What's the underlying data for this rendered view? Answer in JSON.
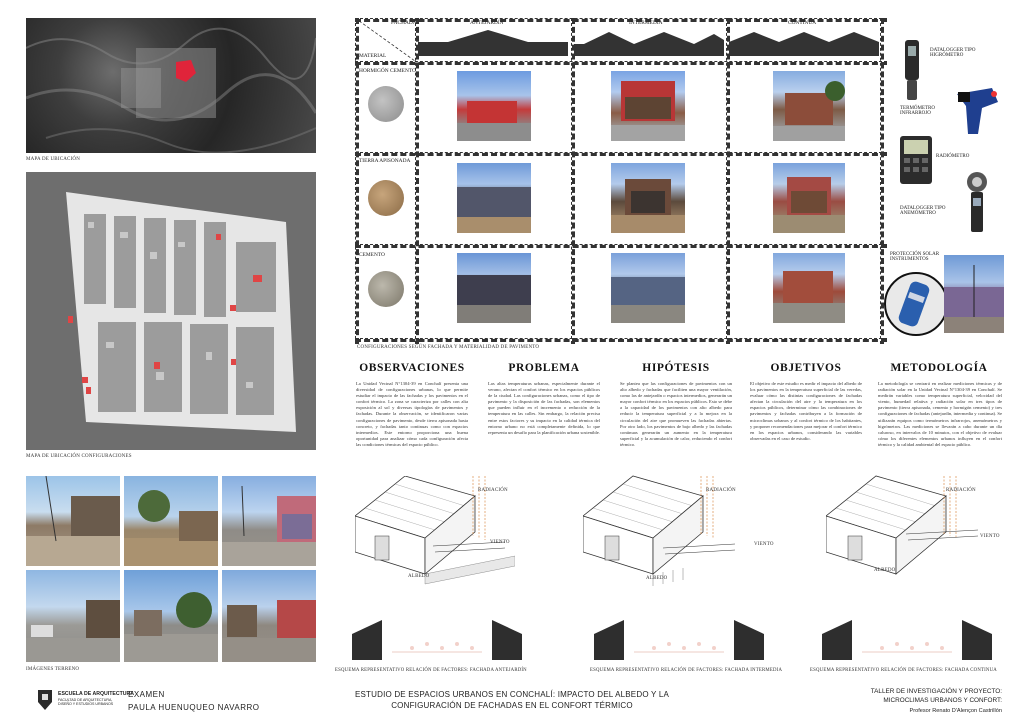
{
  "maps": {
    "ubicacion_caption": "MAPA DE UBICACIÓN",
    "configuraciones_caption": "MAPA DE UBICACIÓN CONFIGURACIONES",
    "terreno_caption": "IMÁGENES TERRENO"
  },
  "matrix": {
    "fachada_label": "FACHADA",
    "material_label": "MATERIAL",
    "columns": [
      "ANTEJARDÍN",
      "INTERMEDIA",
      "CONTINUA"
    ],
    "rows": [
      "HORMIGÓN CEMENTO",
      "TIERRA APISONADA",
      "CEMENTO"
    ],
    "caption": "CONFIGURACIONES SEGÚN FACHADA Y MATERIALIDAD DE PAVIMENTO"
  },
  "instruments": {
    "datalogger_higrometro": "DATALOGGER TIPO HIGRÓMETRO",
    "termometro": "TERMÓMETRO INFRARROJO",
    "radiometro": "RADIÓMETRO",
    "datalogger_anemometro": "DATALOGGER TIPO ANEMÓMETRO",
    "proteccion": "PROTECCIÓN SOLAR INSTRUMENTOS"
  },
  "sections": [
    {
      "title": "OBSERVACIONES",
      "body": "La Unidad Vecinal N°1304-39 en Conchalí presenta una diversidad de configuraciones urbanas, lo que permite estudiar el impacto de las fachadas y los pavimentos en el confort térmico. La zona se caracteriza por calles con alta exposición al sol y diversas tipologías de pavimentos y fachadas. Durante la observación, se identificaron varias configuraciones de pavimento, desde tierra apisonada hasta concreto, y fachadas tanto continuas como con espacios intermedios. Este entorno proporciona una buena oportunidad para analizar cómo cada configuración afecta las condiciones térmicas del espacio público."
    },
    {
      "title": "PROBLEMA",
      "body": "Las altas temperaturas urbanas, especialmente durante el verano, afectan el confort térmico en los espacios públicos de la ciudad. Las configuraciones urbanas, como el tipo de pavimento y la disposición de las fachadas, son elementos que pueden influir en el incremento o reducción de la temperatura en las calles. Sin embargo, la relación precisa entre estos factores y su impacto en la calidad térmica del entorno urbano no está completamente definida, lo que representa un desafío para la planificación urbana sostenible."
    },
    {
      "title": "HIPÓTESIS",
      "body": "Se plantea que las configuraciones de pavimentos con un alto albedo y fachadas que faciliten una mayor ventilación, como las de antejardín o espacios intermedios, generarán un mayor confort térmico en los espacios públicos. Esto se debe a la capacidad de los pavimentos con alto albedo para reducir la temperatura superficial y a la mejora en la circulación del aire que promueven las fachadas abiertas. Por otro lado, los pavimentos de bajo albedo y las fachadas continuas generarán un aumento en la temperatura superficial y la acumulación de calor, reduciendo el confort térmico."
    },
    {
      "title": "OBJETIVOS",
      "body": "El objetivo de este estudio es medir el impacto del albedo de los pavimentos en la temperatura superficial de las veredas, evaluar cómo las distintas configuraciones de fachadas afectan la circulación del aire y la temperatura en los espacios públicos, determinar cómo las combinaciones de pavimentos y fachadas contribuyen a la formación de microclimas urbanos y al confort térmico de los habitantes, y proponer recomendaciones para mejorar el confort térmico en los espacios urbanos, considerando las variables observadas en el caso de estudio."
    },
    {
      "title": "METODOLOGÍA",
      "body": "La metodología se centrará en realizar mediciones térmicas y de radiación solar en la Unidad Vecinal N°1304-39 en Conchalí. Se medirán variables como temperatura superficial, velocidad del viento, humedad relativa y radiación solar en tres tipos de pavimento (tierra apisonada, cemento y hormigón cemento) y tres configuraciones de fachadas (antejardín, intermedia y continua). Se utilizarán equipos como termómetros infrarrojos, anemómetros y higrómetros. Las mediciones se llevarán a cabo durante un día caluroso, en intervalos de 10 minutos, con el objetivo de evaluar cómo los diferentes elementos urbanos influyen en el confort térmico y la calidad ambiental del espacio público."
    }
  ],
  "schemes": {
    "radiacion": "RADIACIÓN",
    "viento": "VIENTO",
    "albedo": "ALBEDO",
    "captions": [
      "ESQUEMA REPRESENTATIVO RELACIÓN DE FACTORES: FACHADA ANTEJARDÍN",
      "ESQUEMA REPRESENTATIVO RELACIÓN DE FACTORES: FACHADA INTERMEDIA",
      "ESQUEMA REPRESENTATIVO RELACIÓN DE FACTORES: FACHADA CONTINUA"
    ]
  },
  "footer": {
    "school_line1": "ESCUELA DE ARQUITECTURA",
    "school_line2": "FACULTAD DE ARQUITECTURA, DISEÑO Y ESTUDIOS URBANOS",
    "exam": "EXAMEN",
    "author": "PAULA HUENUQUEO NAVARRO",
    "title_line1": "ESTUDIO DE ESPACIOS URBANOS EN CONCHALÍ: IMPACTO DEL ALBEDO Y LA",
    "title_line2": "CONFIGURACIÓN DE FACHADAS EN EL CONFORT TÉRMICO",
    "workshop_line1": "TALLER DE INVESTIGACIÓN Y PROYECTO:",
    "workshop_line2": "MICROCLIMAS URBANOS Y CONFORT:",
    "professor": "Profesor Renato D'Alençon Castrillón"
  }
}
